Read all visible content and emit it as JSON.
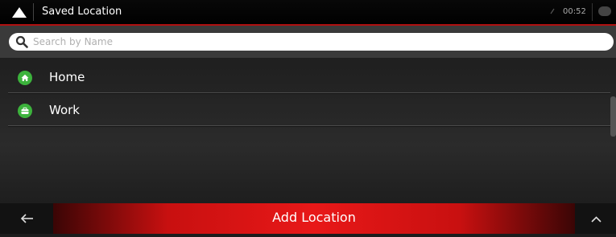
{
  "header": {
    "title": "Saved Location",
    "time": "00:52",
    "logo_icon": "navigation-arrow-icon",
    "status_icon": "gps-signal-icon",
    "message_icon": "message-icon"
  },
  "search": {
    "placeholder": "Search by Name",
    "value": "",
    "icon": "search-icon"
  },
  "locations": [
    {
      "label": "Home",
      "icon": "home-icon",
      "icon_color": "#3cb33c"
    },
    {
      "label": "Work",
      "icon": "briefcase-icon",
      "icon_color": "#3cb33c"
    }
  ],
  "footer": {
    "back_icon": "back-arrow-icon",
    "add_label": "Add Location",
    "up_icon": "chevron-up-icon"
  },
  "colors": {
    "accent": "#e81818",
    "header_border": "#b01010",
    "icon_green": "#3cb33c"
  }
}
